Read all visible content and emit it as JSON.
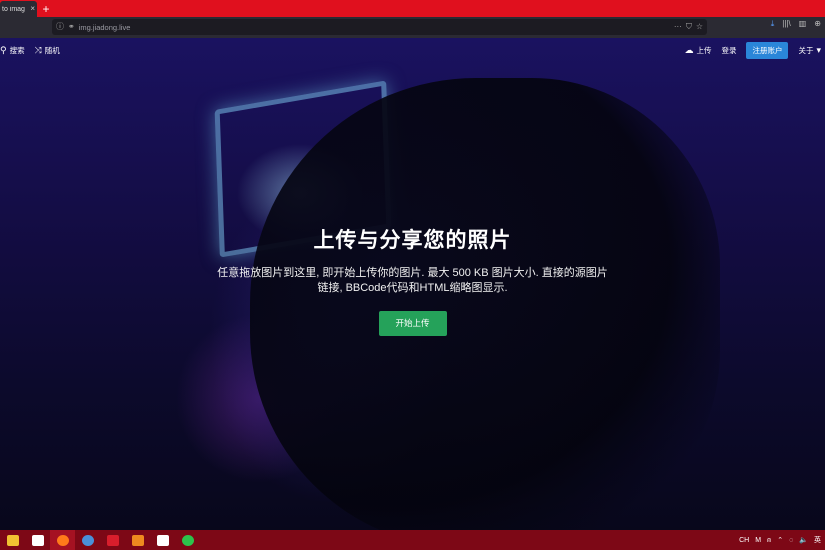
{
  "browser": {
    "tab_title": "to imag",
    "tab_close": "×",
    "new_tab": "+",
    "url": "img.jiadong.live",
    "icons": [
      "info-icon",
      "shield-icon",
      "more-icon",
      "pocket-icon",
      "star-icon",
      "download-icon",
      "library-icon",
      "sidebar-icon",
      "extension-icon"
    ],
    "nav_glyphs": {
      "info": "ⓘ",
      "shield": "⚭",
      "more": "···",
      "pocket": "⛉",
      "star": "☆",
      "download": "⤓",
      "library": "|||\\",
      "sidebar": "▥",
      "extension": "⊕"
    }
  },
  "site": {
    "search_label": "搜索",
    "random_label": "随机",
    "upload_label": "上传",
    "login_label": "登录",
    "register_label": "注册账户",
    "about_label": "关于",
    "glyphs": {
      "search": "⚲",
      "random": "⤨",
      "cloud": "☁",
      "caret": "▾"
    }
  },
  "hero": {
    "title": "上传与分享您的照片",
    "description_line1": "任意拖放图片到这里, 即开始上传你的图片. 最大 500 KB 图片大小. 直接的源图片",
    "description_line2": "链接, BBCode代码和HTML缩略图显示.",
    "start_button": "开始上传"
  },
  "taskbar": {
    "items": [
      {
        "name": "file-explorer-icon",
        "color": "#f1c232"
      },
      {
        "name": "mail-icon",
        "color": "#ffffff"
      },
      {
        "name": "firefox-icon",
        "color": "#ff7a1a"
      },
      {
        "name": "chrome-icon",
        "color": "#4a90d9"
      },
      {
        "name": "dictionary-app-icon",
        "color": "#d81e2c"
      },
      {
        "name": "sublime-icon",
        "color": "#ef8a1f"
      },
      {
        "name": "acrobat-icon",
        "color": "#ffffff"
      },
      {
        "name": "wechat-icon",
        "color": "#2dc24b"
      }
    ],
    "ime": "CH",
    "ime_mode": "M",
    "tray_glyphs": {
      "person": "⍝",
      "up": "⌃",
      "net": "◌",
      "vol": "🔈",
      "lang": "英"
    }
  },
  "colors": {
    "accent_red": "#e0101e",
    "register_blue": "#2a86d9",
    "start_green": "#25a25a",
    "taskbar": "#7d0816"
  }
}
